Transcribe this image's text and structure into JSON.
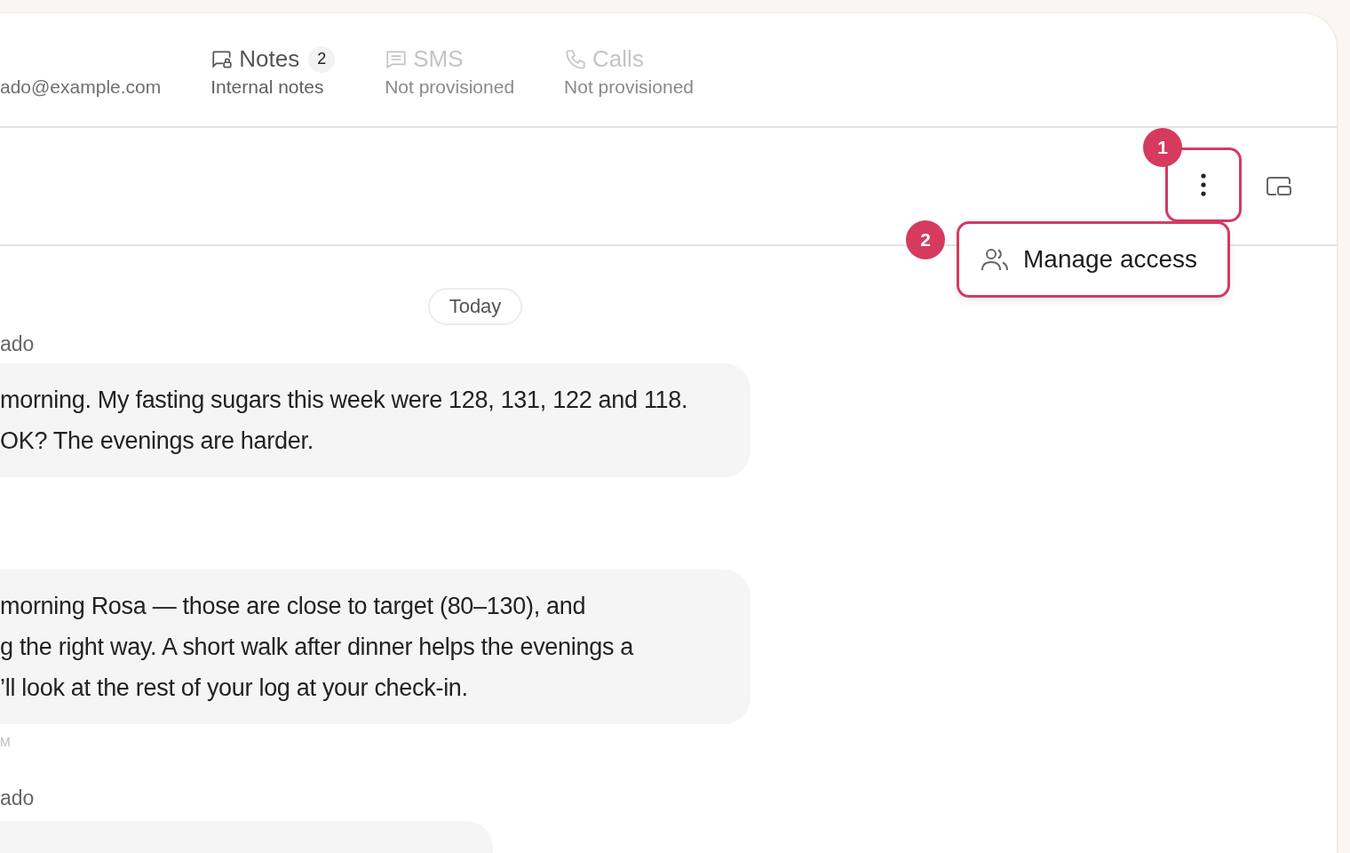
{
  "tabs": [
    {
      "kind": "email",
      "subtitle": "ado@example.com",
      "selected": false,
      "disabled": false
    },
    {
      "kind": "notes",
      "title": "Notes",
      "count": "2",
      "subtitle": "Internal notes",
      "selected": true,
      "disabled": false
    },
    {
      "kind": "sms",
      "title": "SMS",
      "subtitle": "Not provisioned",
      "selected": false,
      "disabled": true
    },
    {
      "kind": "calls",
      "title": "Calls",
      "subtitle": "Not provisioned",
      "selected": false,
      "disabled": true
    }
  ],
  "menu": {
    "items": [
      {
        "label": "Manage access"
      }
    ]
  },
  "annotations": [
    "1",
    "2"
  ],
  "chat": {
    "date_divider": "Today",
    "messages": [
      {
        "sender": "ado",
        "lines": [
          "morning. My fasting sugars this week were 128, 131, 122 and 118.",
          "OK? The evenings are harder."
        ]
      },
      {
        "lines": [
          "morning Rosa — those are close to target (80–130), and",
          "g the right way. A short walk after dinner helps the evenings a",
          "’ll look at the rest of your log at your check-in."
        ],
        "time": "M"
      },
      {
        "sender": "ado"
      }
    ]
  }
}
